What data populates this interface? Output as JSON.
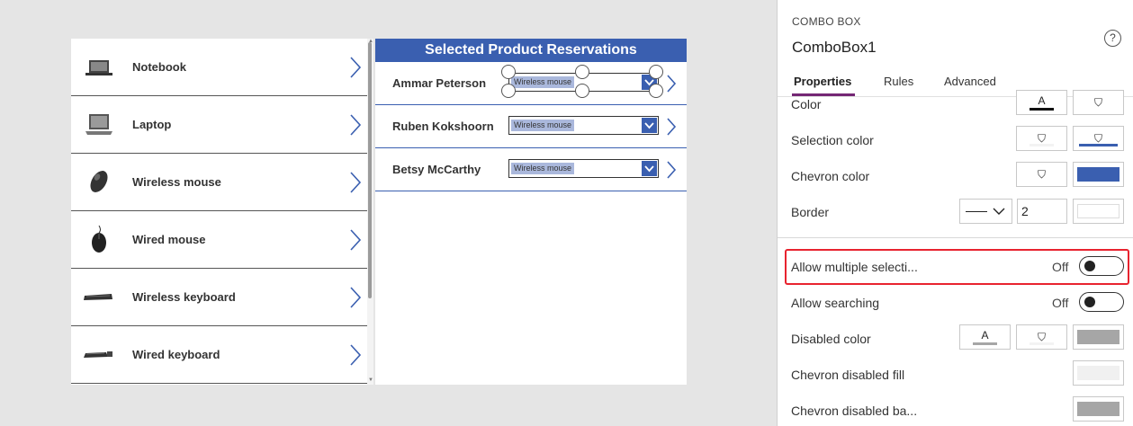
{
  "gallery": {
    "items": [
      {
        "label": "Notebook",
        "icon": "notebook-icon"
      },
      {
        "label": "Laptop",
        "icon": "laptop-icon"
      },
      {
        "label": "Wireless mouse",
        "icon": "wireless-mouse-icon"
      },
      {
        "label": "Wired mouse",
        "icon": "wired-mouse-icon"
      },
      {
        "label": "Wireless keyboard",
        "icon": "wireless-keyboard-icon"
      },
      {
        "label": "Wired keyboard",
        "icon": "wired-keyboard-icon"
      }
    ]
  },
  "reservations": {
    "title": "Selected Product Reservations",
    "rows": [
      {
        "name": "Ammar Peterson",
        "combo_value": "Wireless mouse"
      },
      {
        "name": "Ruben Kokshoorn",
        "combo_value": "Wireless mouse"
      },
      {
        "name": "Betsy McCarthy",
        "combo_value": "Wireless mouse"
      }
    ]
  },
  "pane": {
    "control_type": "COMBO BOX",
    "control_name": "ComboBox1",
    "help": "?",
    "tabs": {
      "properties": "Properties",
      "rules": "Rules",
      "advanced": "Advanced"
    },
    "props": {
      "color": "Color",
      "selection_color": "Selection color",
      "chevron_color": "Chevron color",
      "border": "Border",
      "border_width": "2",
      "allow_multiple": "Allow multiple selecti...",
      "allow_multiple_state": "Off",
      "allow_searching": "Allow searching",
      "allow_searching_state": "Off",
      "disabled_color": "Disabled color",
      "chevron_disabled_fill": "Chevron disabled fill",
      "chevron_disabled_background": "Chevron disabled ba..."
    },
    "swatch_glyph_text": "A"
  },
  "colors": {
    "accent_blue": "#3a5fb0",
    "tab_underline": "#742774",
    "highlight_red": "#e8232f",
    "disabled_gray": "#a6a6a6",
    "chevron_disabled_fill": "#f0f0f0"
  }
}
